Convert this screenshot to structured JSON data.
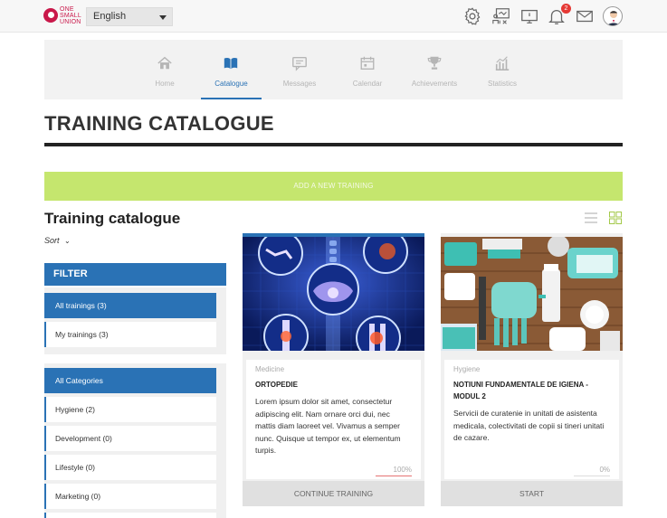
{
  "header": {
    "logo_text": "ONE SMALL UNION",
    "language": "English",
    "notifications_count": "2",
    "icons": [
      "gear-icon",
      "presentation-icon",
      "monitor-icon",
      "bell-icon",
      "mail-icon",
      "avatar"
    ]
  },
  "nav": {
    "items": [
      {
        "label": "Home",
        "icon": "home-icon"
      },
      {
        "label": "Catalogue",
        "icon": "book-icon",
        "active": true
      },
      {
        "label": "Messages",
        "icon": "chat-icon"
      },
      {
        "label": "Calendar",
        "icon": "calendar-icon"
      },
      {
        "label": "Achievements",
        "icon": "trophy-icon"
      },
      {
        "label": "Statistics",
        "icon": "stats-icon"
      }
    ]
  },
  "page": {
    "title": "TRAINING CATALOGUE",
    "add_button": "ADD A NEW TRAINING",
    "subtitle": "Training catalogue",
    "sort": "Sort"
  },
  "filter": {
    "heading": "FILTER",
    "scope": [
      "All trainings (3)",
      "My trainings (3)"
    ],
    "categories": [
      "All Categories",
      "Hygiene (2)",
      "Development (0)",
      "Lifestyle (0)",
      "Marketing (0)"
    ]
  },
  "cards": [
    {
      "category": "Medicine",
      "title": "ORTOPEDIE",
      "description": "Lorem ipsum dolor sit amet, consectetur adipiscing elit. Nam ornare orci dui, nec mattis diam laoreet vel. Vivamus a semper nunc. Quisque ut tempor ex, ut elementum turpis.",
      "progress": "100%",
      "progress_value": 1.0,
      "action": "CONTINUE TRAINING"
    },
    {
      "category": "Hygiene",
      "title": "NOTIUNI FUNDAMENTALE DE IGIENA - MODUL 2",
      "description": "Servicii de curatenie in unitati de asistenta medicala, colectivitati de copii si tineri unitati de cazare.",
      "progress": "0%",
      "progress_value": 0.0,
      "action": "START"
    }
  ],
  "colors": {
    "primary": "#2a72b5",
    "add_button": "#c5e66e",
    "brand": "#c9184a",
    "badge": "#e53935"
  }
}
